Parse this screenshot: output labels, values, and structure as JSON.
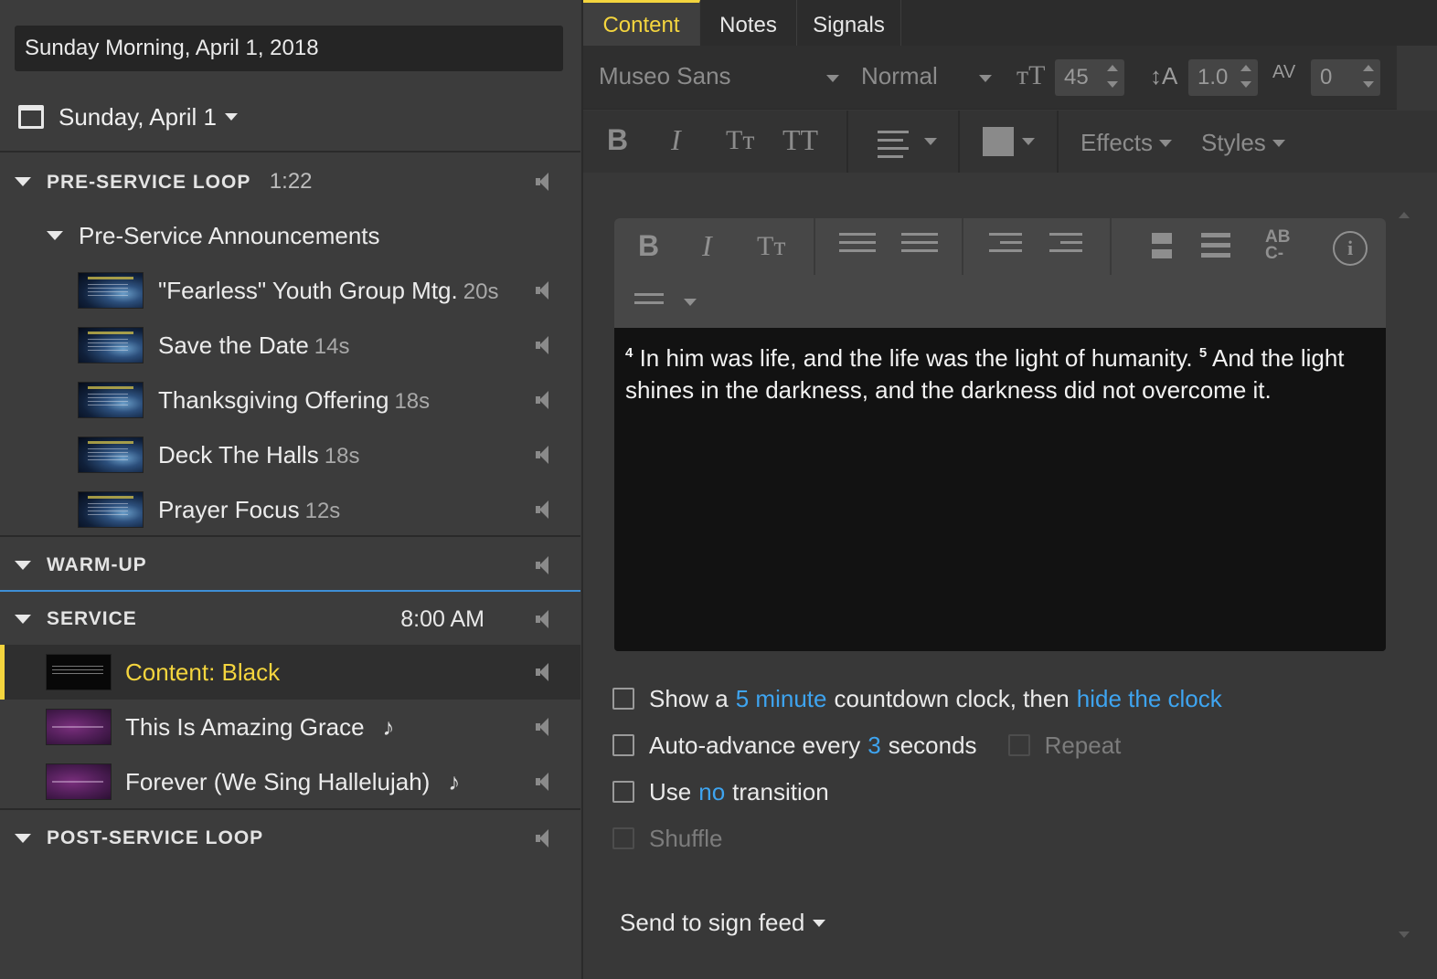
{
  "plan": {
    "title": "Sunday Morning, April 1, 2018",
    "date": "Sunday, April 1"
  },
  "sections": [
    {
      "label": "PRE-SERVICE LOOP",
      "time": "1:22",
      "group": "Pre-Service Announcements",
      "items": [
        {
          "title": "\"Fearless\" Youth Group Mtg.",
          "duration": "20s"
        },
        {
          "title": "Save the Date",
          "duration": "14s"
        },
        {
          "title": "Thanksgiving Offering",
          "duration": "18s"
        },
        {
          "title": "Deck The Halls",
          "duration": "18s"
        },
        {
          "title": "Prayer Focus",
          "duration": "12s"
        }
      ]
    },
    {
      "label": "WARM-UP"
    },
    {
      "label": "SERVICE",
      "time": "8:00 AM",
      "items": [
        {
          "title": "Content: Black",
          "active": true
        },
        {
          "title": "This Is Amazing Grace",
          "icon": "music-note-icon"
        },
        {
          "title": "Forever (We Sing Hallelujah)",
          "icon": "music-note-icon"
        }
      ]
    },
    {
      "label": "POST-SERVICE LOOP"
    }
  ],
  "tabs": [
    "Content",
    "Notes",
    "Signals"
  ],
  "active_tab": "Content",
  "toolbar": {
    "font": "Museo Sans",
    "weight": "Normal",
    "size": "45",
    "line_height": "1.0",
    "tracking": "0",
    "effects": "Effects",
    "styles": "Styles"
  },
  "editor": {
    "verse1_num": "4",
    "verse1_text": " In him was life, and the life was the light of humanity. ",
    "verse2_num": "5",
    "verse2_text": " And the light shines in the darkness, and the darkness did not overcome it."
  },
  "options": {
    "countdown": {
      "pre": "Show a",
      "value": "5 minute",
      "mid": "countdown clock, then",
      "action": "hide the clock"
    },
    "advance": {
      "pre": "Auto-advance every",
      "value": "3",
      "post": "seconds",
      "repeat": "Repeat"
    },
    "transition": {
      "pre": "Use",
      "value": "no",
      "post": "transition"
    },
    "shuffle": "Shuffle"
  },
  "send_label": "Send to sign feed",
  "colors": {
    "accent": "#f4d53e",
    "link": "#3ea4f0",
    "panel": "#3c3c3c"
  }
}
